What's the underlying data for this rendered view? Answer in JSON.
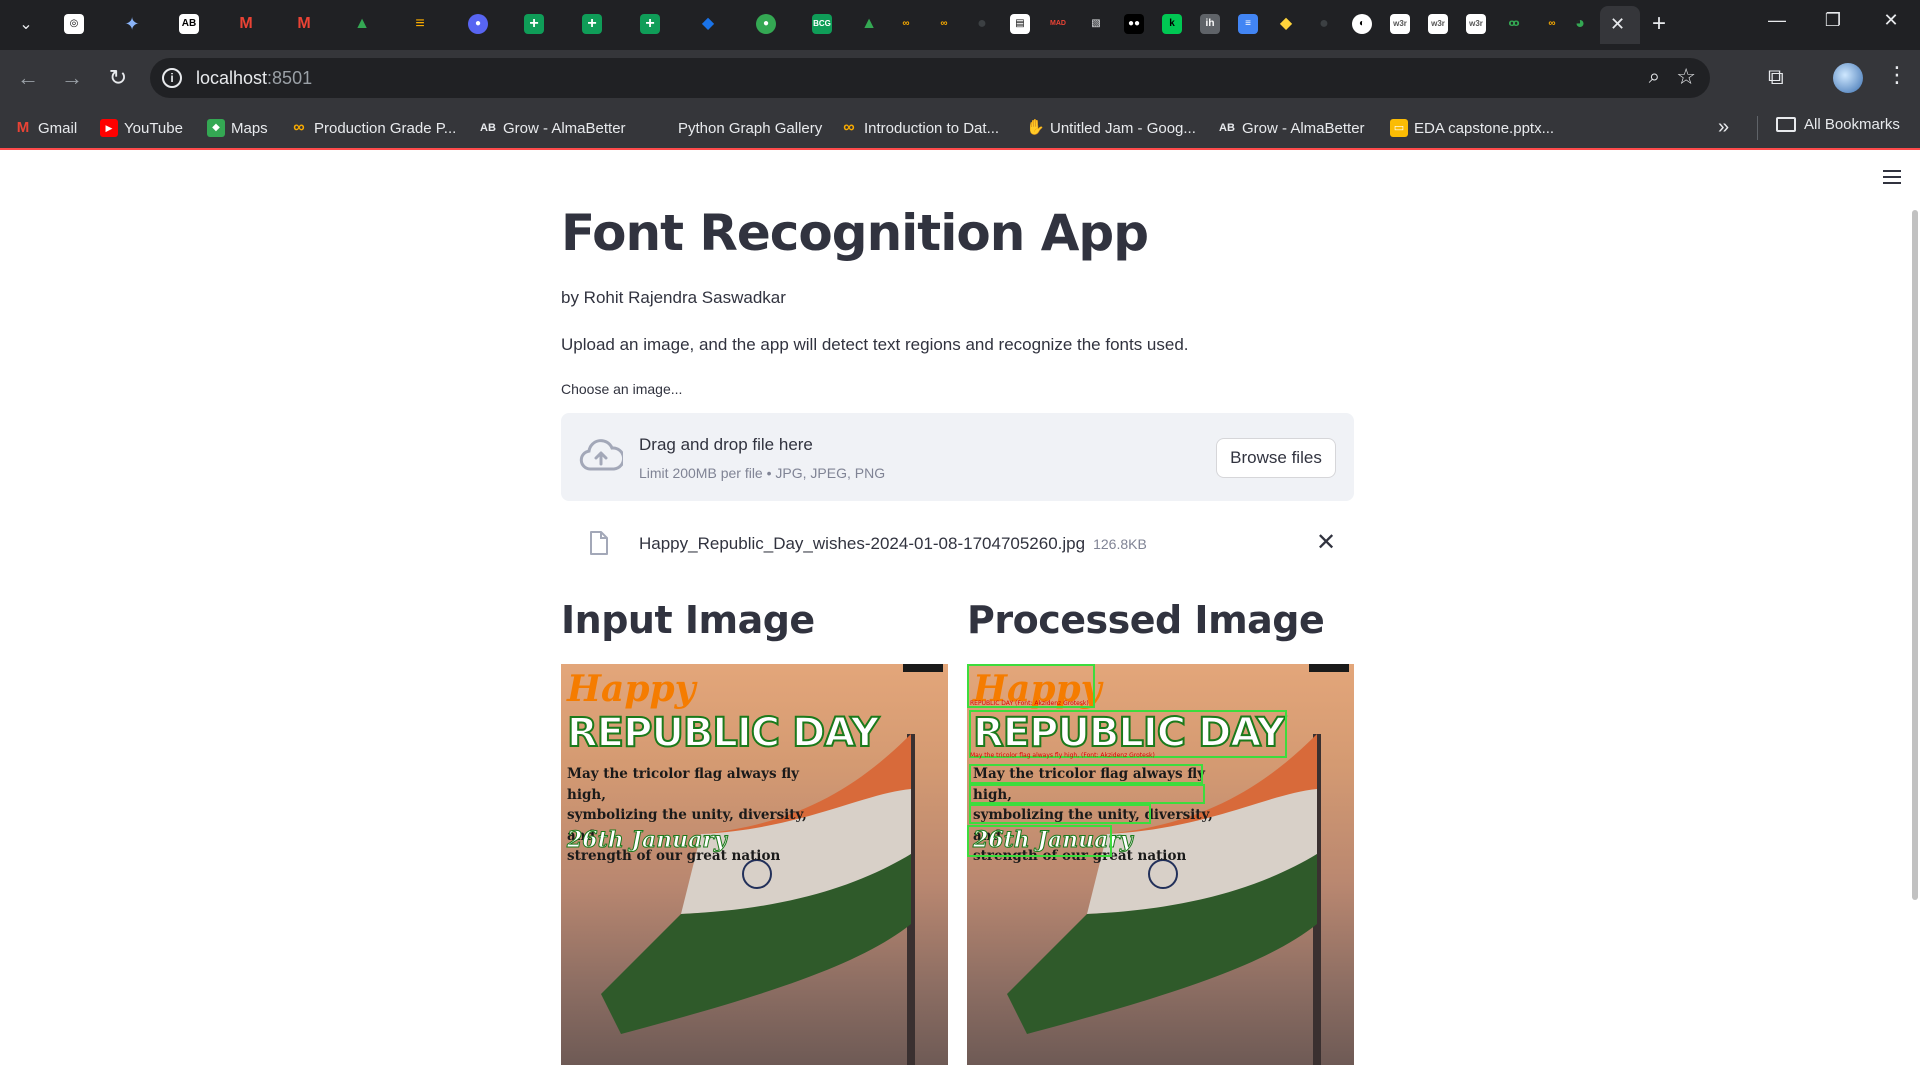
{
  "browser": {
    "url_host": "localhost",
    "url_port": ":8501",
    "bookmarks": [
      {
        "label": "Gmail",
        "icon": "gmail-icon",
        "color": "#ea4335"
      },
      {
        "label": "YouTube",
        "icon": "youtube-icon",
        "color": "#ff0000"
      },
      {
        "label": "Maps",
        "icon": "maps-icon",
        "color": "#34a853"
      },
      {
        "label": "Production Grade P...",
        "icon": "infinity-icon",
        "color": "#f9ab00"
      },
      {
        "label": "Grow - AlmaBetter",
        "icon": "almabetter-icon",
        "color": "#e8eaed"
      },
      {
        "label": "Python Graph Gallery",
        "icon": "",
        "color": ""
      },
      {
        "label": "Introduction to Dat...",
        "icon": "infinity-icon",
        "color": "#f9ab00"
      },
      {
        "label": "Untitled Jam - Goog...",
        "icon": "jamboard-icon",
        "color": "#f9ab00"
      },
      {
        "label": "Grow - AlmaBetter",
        "icon": "almabetter-icon",
        "color": "#e8eaed"
      },
      {
        "label": "EDA capstone.pptx...",
        "icon": "slides-icon",
        "color": "#fbbc04"
      }
    ],
    "all_bookmarks": "All Bookmarks"
  },
  "app": {
    "title": "Font Recognition App",
    "author": "by Rohit Rajendra Saswadkar",
    "description": "Upload an image, and the app will detect text regions and recognize the fonts used.",
    "uploader": {
      "label": "Choose an image...",
      "drop_text": "Drag and drop file here",
      "limit_text": "Limit 200MB per file • JPG, JPEG, PNG",
      "browse_label": "Browse files"
    },
    "uploaded_file": {
      "name": "Happy_Republic_Day_wishes-2024-01-08-1704705260.jpg",
      "size": "126.8KB"
    },
    "input_header": "Input Image",
    "processed_header": "Processed Image",
    "accent_color": "#ff4b4b",
    "poster": {
      "happy": "Happy",
      "republic": "REPUBLIC DAY",
      "body_lines": [
        "May the tricolor flag always fly high,",
        "symbolizing the unity, diversity, and",
        "strength of our great nation"
      ],
      "date": "26th January"
    },
    "detections": [
      {
        "label": "REPUBLIC DAY (Font: Akzidenz Grotesk)"
      },
      {
        "label": "May the tricolor flag always fly high, (Font: Akzidenz Grotesk)"
      }
    ]
  }
}
